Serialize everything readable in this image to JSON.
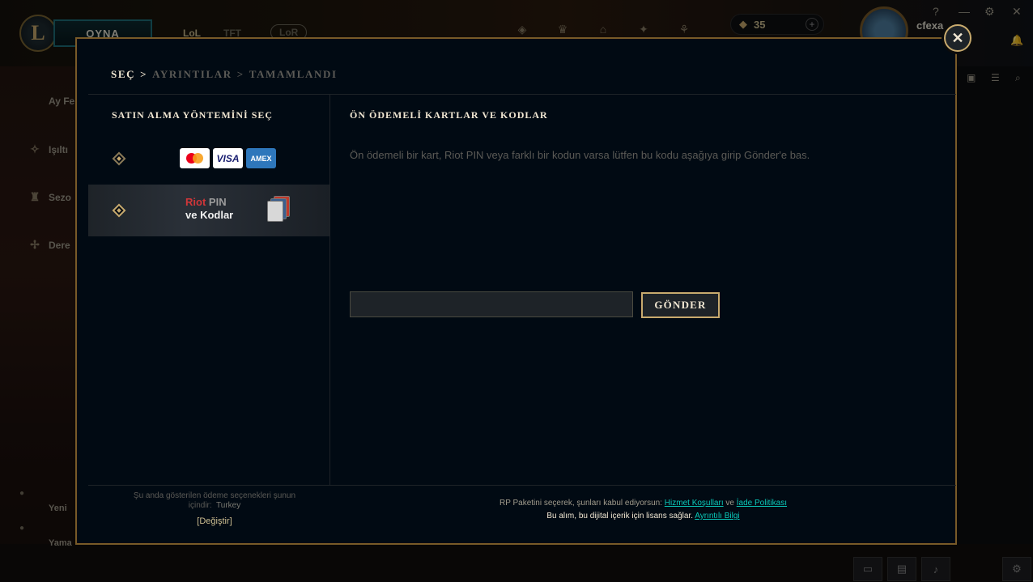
{
  "client": {
    "play_button": "OYNA",
    "tabs": [
      "LoL",
      "TFT",
      "LoR"
    ],
    "rp_balance": "35",
    "username": "cfexa",
    "sidebar_items": [
      "Ay Fe",
      "Işıltı",
      "Sezo",
      "Dere"
    ],
    "sidebar_bottom": [
      "Yeni",
      "Yama"
    ],
    "window_controls": [
      "?",
      "—",
      "⚙",
      "✕"
    ]
  },
  "modal": {
    "breadcrumb": {
      "step1": "SEÇ",
      "step2": "AYRINTILAR",
      "step3": "TAMAMLANDI",
      "separator": ">"
    },
    "close_icon": "close-icon",
    "left_panel": {
      "title": "SATIN ALMA YÖNTEMİNİ SEÇ",
      "methods": [
        {
          "id": "credit-cards",
          "cards": [
            "mastercard",
            "VISA",
            "AMEX"
          ]
        },
        {
          "id": "riot-pin",
          "riot": "Riot",
          "pin": "PIN",
          "codes": "ve Kodlar"
        }
      ],
      "selected_index": 1
    },
    "right_panel": {
      "title": "ÖN ÖDEMELİ KARTLAR VE KODLAR",
      "description": "Ön ödemeli bir kart, Riot PIN veya farklı bir kodun varsa lütfen bu kodu aşağıya girip Gönder'e bas.",
      "input_value": "",
      "input_placeholder": "",
      "submit_label": "GÖNDER"
    },
    "footer_left": {
      "line1": "Şu anda gösterilen ödeme seçenekleri şunun",
      "line2_prefix": "içindir:",
      "country": "Turkey",
      "change_link": "[Değiştir]"
    },
    "footer_right": {
      "line1_prefix": "RP Paketini seçerek, şunları kabul ediyorsun:",
      "terms_link": "Hizmet Koşulları",
      "and": "ve",
      "refund_link": "İade Politikası",
      "line2_prefix": "Bu alım, bu dijital içerik için lisans sağlar.",
      "more_info_link": "Ayrıntılı Bilgi"
    }
  },
  "colors": {
    "gold": "#c8aa6e",
    "gold_border": "#785a28",
    "modal_bg": "#010a13",
    "teal_link": "#0ac8b9",
    "riot_red": "#d13639"
  }
}
